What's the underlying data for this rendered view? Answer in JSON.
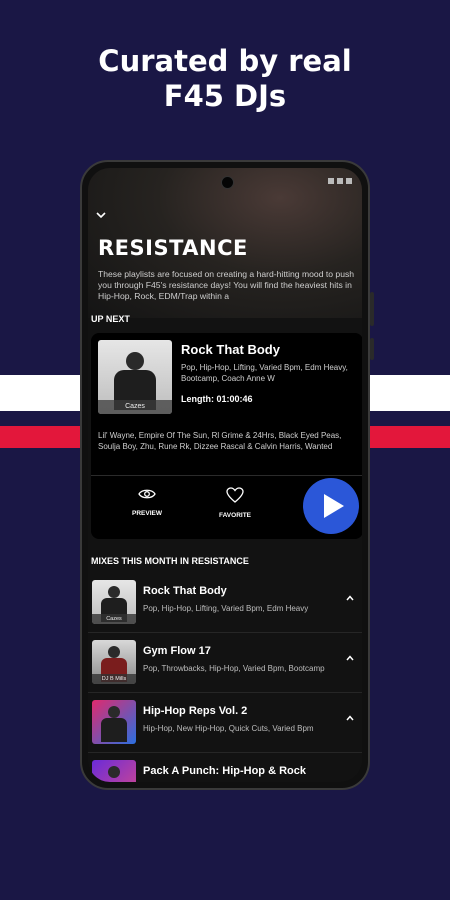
{
  "headline": {
    "line1": "Curated by real",
    "line2": "F45 DJs"
  },
  "colors": {
    "background": "#1a1745",
    "accent_play": "#2b57d8",
    "stripe_red": "#e3173b",
    "stripe_white": "#ffffff"
  },
  "header": {
    "back_icon": "chevron-down-icon",
    "title": "RESISTANCE",
    "description": "These playlists are focused on creating a hard-hitting mood to push you through F45's resistance days! You will find the heaviest hits in Hip-Hop, Rock, EDM/Trap within a"
  },
  "up_next": {
    "label": "UP NEXT",
    "title": "Rock That Body",
    "tags": "Pop, Hip-Hop, Lifting, Varied Bpm, Edm Heavy, Bootcamp, Coach Anne W",
    "length": "Length: 01:00:46",
    "thumb_tag": "Cazes",
    "artists": "Lil' Wayne, Empire Of The Sun, Rl Grime & 24Hrs, Black Eyed Peas, Soulja Boy, Zhu, Rune Rk, Dizzee Rascal & Calvin Harris, Wanted",
    "preview_label": "PREVIEW",
    "favorite_label": "FAVORITE"
  },
  "mixes": {
    "label": "MIXES THIS MONTH IN RESISTANCE",
    "items": [
      {
        "title": "Rock That Body",
        "tags": "Pop, Hip-Hop, Lifting, Varied Bpm, Edm Heavy",
        "thumb_tag": "Cazes"
      },
      {
        "title": "Gym Flow 17",
        "tags": "Pop, Throwbacks, Hip-Hop, Varied Bpm, Bootcamp",
        "thumb_tag": "DJ B Mills"
      },
      {
        "title": "Hip-Hop Reps Vol. 2",
        "tags": "Hip-Hop, New Hip-Hop, Quick Cuts, Varied Bpm",
        "thumb_tag": ""
      },
      {
        "title": "Pack A Punch: Hip-Hop & Rock",
        "tags": "",
        "thumb_tag": ""
      }
    ]
  }
}
